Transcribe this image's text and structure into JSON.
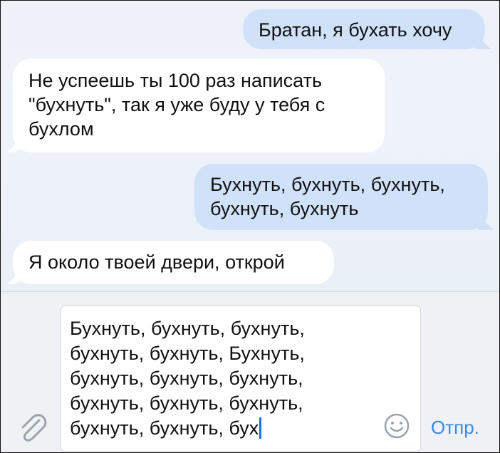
{
  "messages": [
    {
      "direction": "outgoing",
      "text": "Братан, я бухать хочу"
    },
    {
      "direction": "incoming",
      "text": "Не успеешь ты 100 раз написать \"бухнуть\",  так я уже буду у тебя с бухлом"
    },
    {
      "direction": "outgoing",
      "text": "Бухнуть, бухнуть, бухнуть, бухнуть, бухнуть"
    },
    {
      "direction": "incoming",
      "text": "Я около твоей двери, открой"
    }
  ],
  "compose": {
    "text": "Бухнуть, бухнуть, бухнуть,\nбухнуть, бухнуть, Бухнуть,\nбухнуть, бухнуть, бухнуть,\nбухнуть, бухнуть, бухнуть,\nбухнуть, бухнуть, бух",
    "send_label": "Отпр.",
    "attach_icon": "paperclip-icon",
    "emoji_icon": "smiley-icon"
  },
  "colors": {
    "outgoing_bubble": "#cfe2f9",
    "incoming_bubble": "#ffffff",
    "chat_background": "#eef1f8",
    "send_text": "#3a8bdc",
    "caret": "#1a6fe6"
  }
}
